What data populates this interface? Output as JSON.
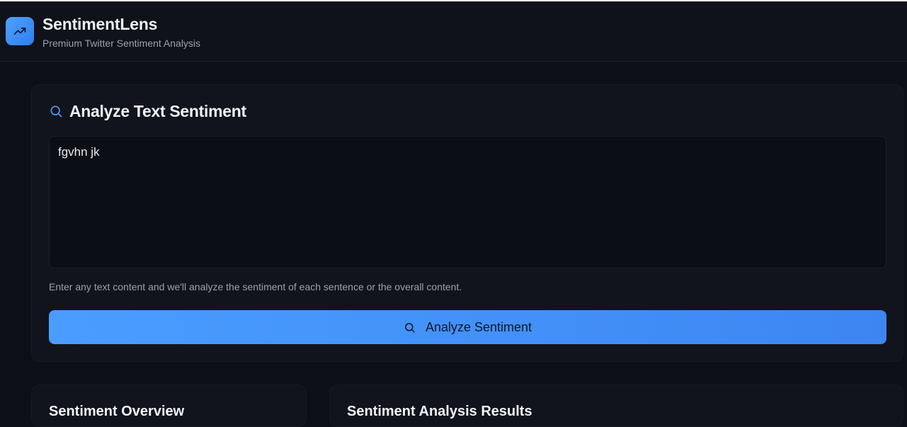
{
  "header": {
    "app_title": "SentimentLens",
    "app_subtitle": "Premium Twitter Sentiment Analysis",
    "logo_icon": "trending-up-icon"
  },
  "analyze_card": {
    "title": "Analyze Text Sentiment",
    "title_icon": "search-icon",
    "input_value": "fgvhn jk",
    "helper_text": "Enter any text content and we'll analyze the sentiment of each sentence or the overall content.",
    "button_label": "Analyze Sentiment",
    "button_icon": "search-icon"
  },
  "lower_cards": {
    "left_title": "Sentiment Overview",
    "right_title": "Sentiment Analysis Results"
  },
  "colors": {
    "background": "#0c0f15",
    "card": "#11141c",
    "accent": "#4a9dff"
  }
}
